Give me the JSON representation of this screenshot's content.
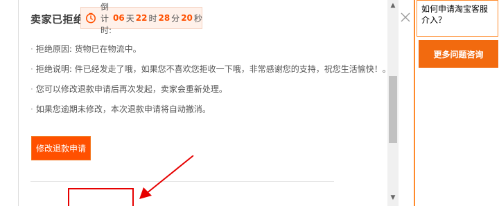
{
  "status": {
    "title": "卖家已拒绝",
    "countdown": {
      "label": "倒计时:",
      "days": "06",
      "days_unit": "天",
      "hours": "22",
      "hours_unit": "时",
      "minutes": "28",
      "minutes_unit": "分",
      "seconds": "20",
      "seconds_unit": "秒"
    }
  },
  "reasons": [
    "拒绝原因: 货物已在物流中。",
    "拒绝说明: 件已经发走了哦，如果您不喜欢您拒收一下哦，非常感谢您的支持，祝您生活愉快！。",
    "您可以修改退款申请后再次发起，卖家会重新处理。",
    "如果您逾期未修改，本次退款申请将自动撤消。"
  ],
  "bullet": "·",
  "modify_button": "修改退款申请",
  "help": {
    "question": "如何申请淘宝客服介入？",
    "more_button": "更多问题咨询"
  },
  "scroll": {
    "up": "▲",
    "down": "▼"
  },
  "colors": {
    "accent": "#ff5000",
    "annotation_red": "#e60000",
    "help_orange": "#f26a0f"
  }
}
